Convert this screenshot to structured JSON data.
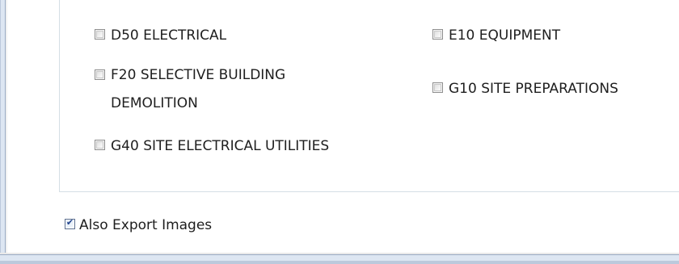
{
  "categories": {
    "items": [
      {
        "label": "D50 ELECTRICAL",
        "checked": false
      },
      {
        "label": "E10 EQUIPMENT",
        "checked": false
      },
      {
        "label": "F20 SELECTIVE BUILDING DEMOLITION",
        "checked": false
      },
      {
        "label": "G10 SITE PREPARATIONS",
        "checked": false
      },
      {
        "label": "G40 SITE ELECTRICAL UTILITIES",
        "checked": false
      }
    ]
  },
  "options": {
    "export_images_label": "Also Export Images",
    "export_images_checked": true
  }
}
